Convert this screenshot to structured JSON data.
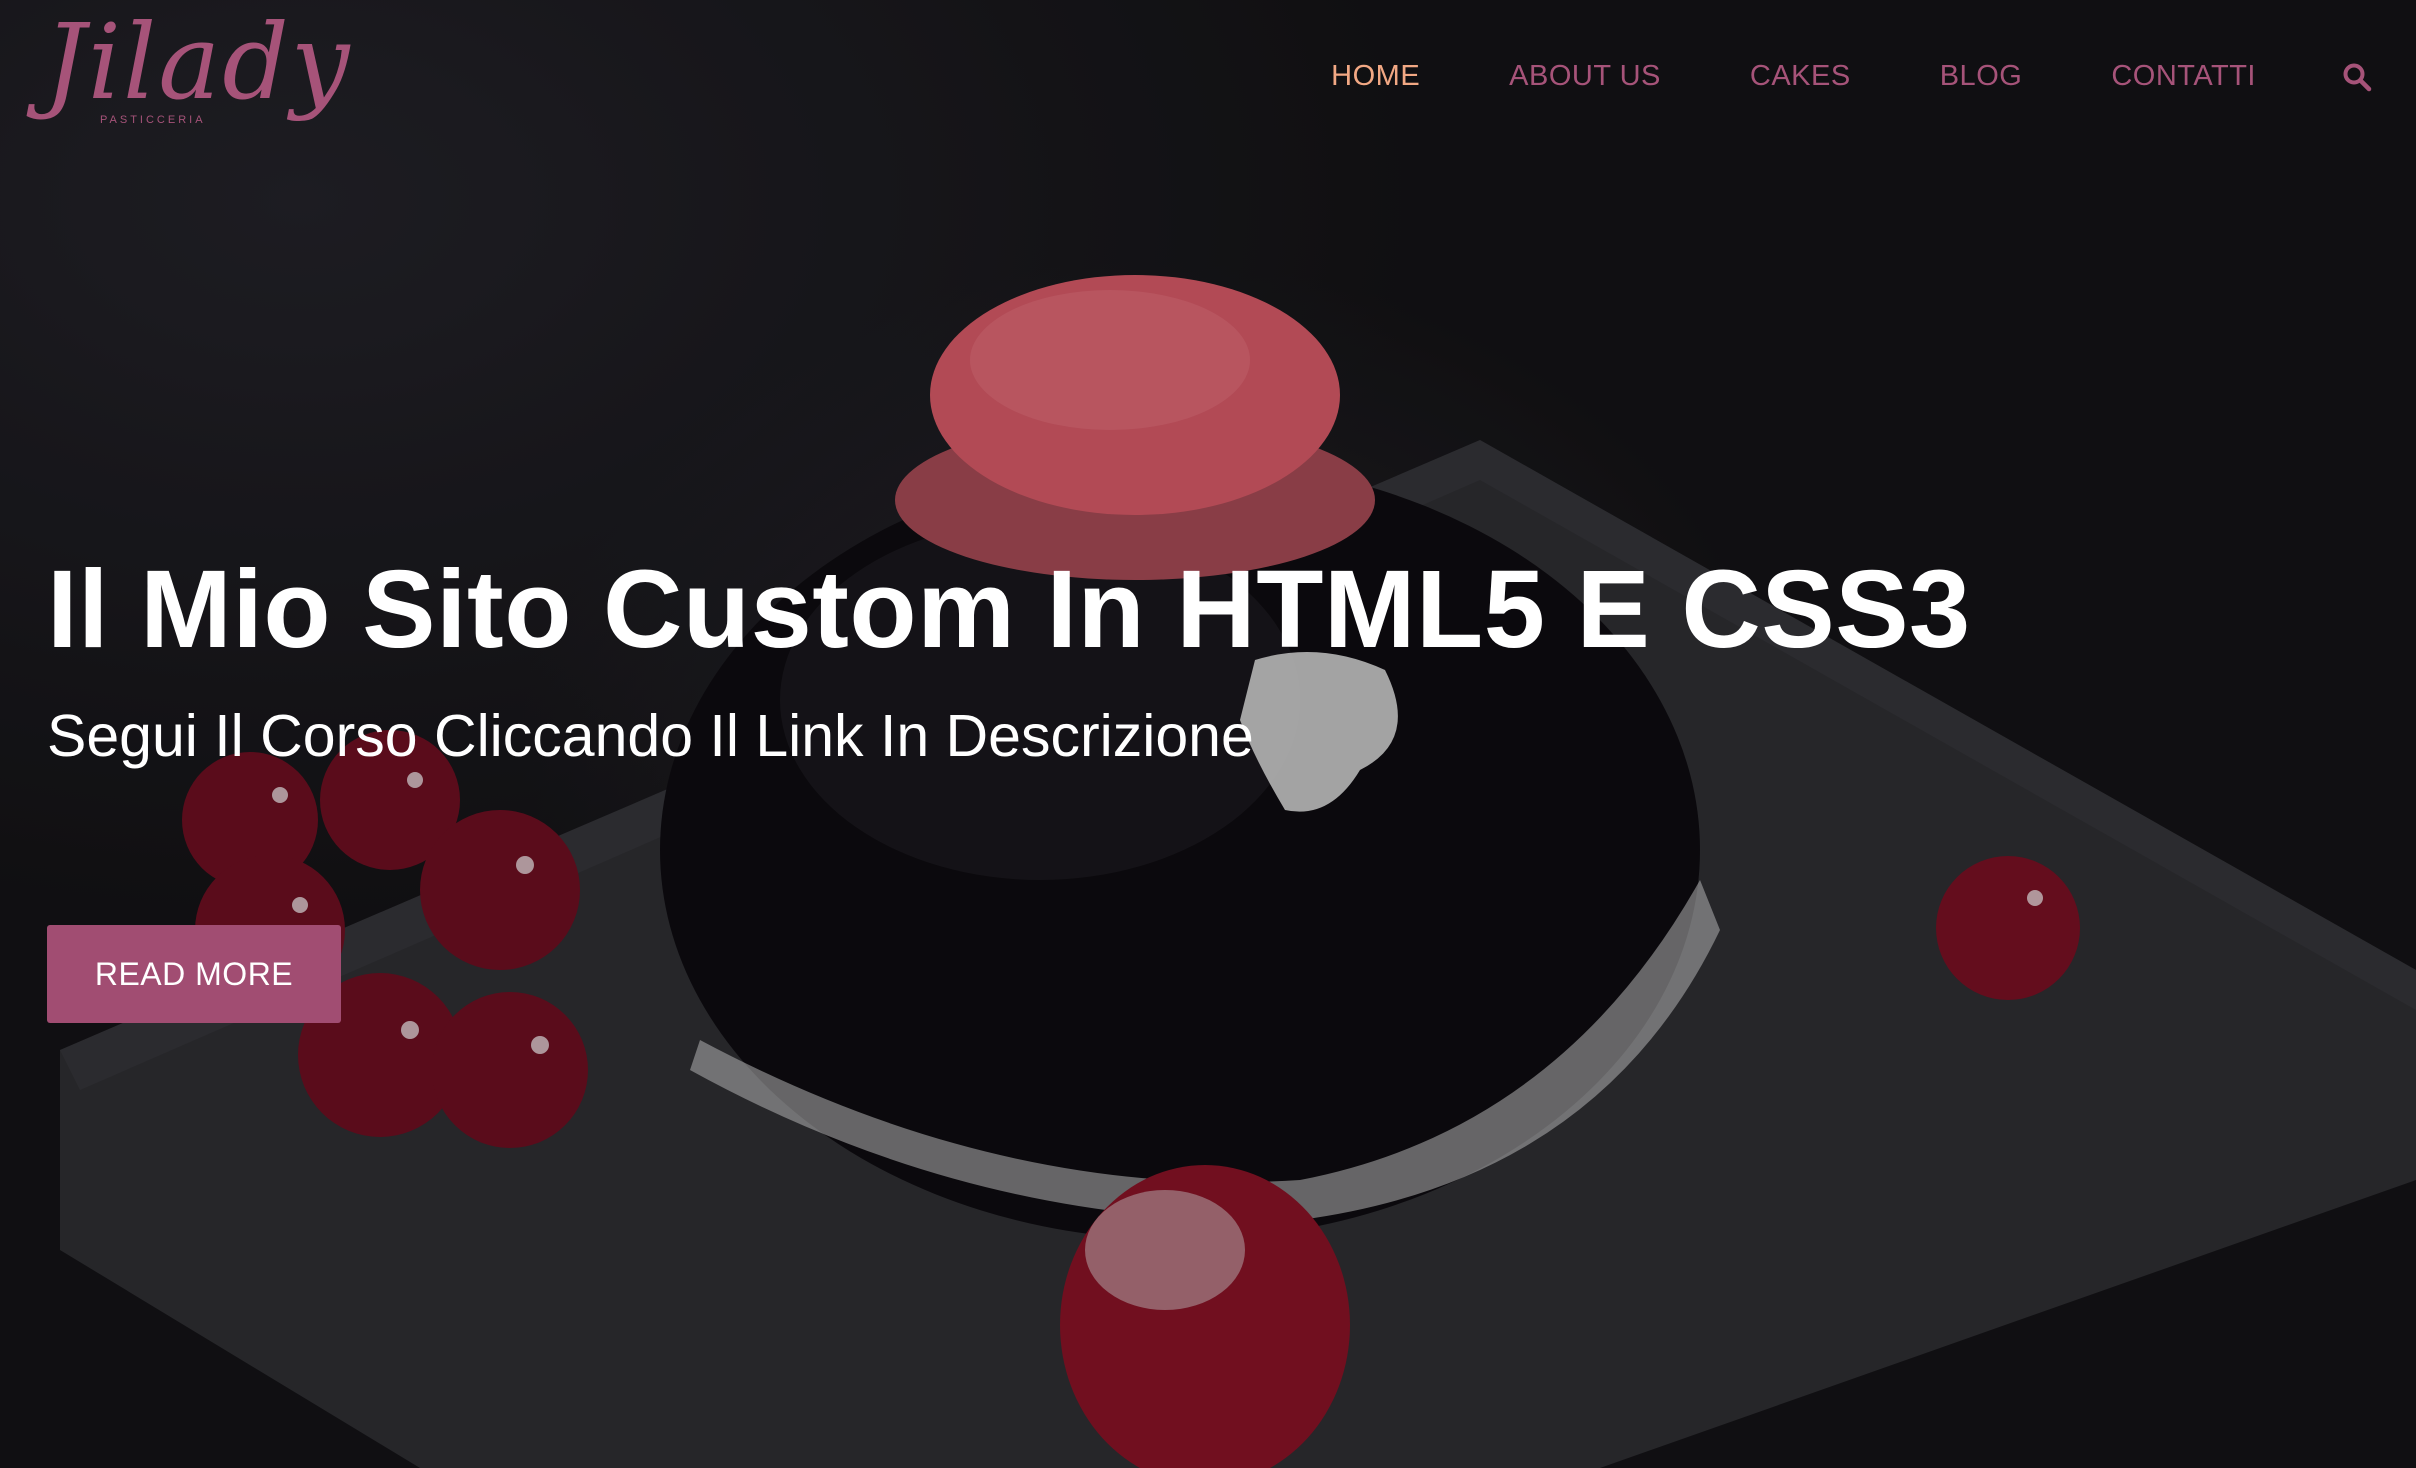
{
  "brand": {
    "logo_text": "Jilady",
    "logo_sub": "PASTICCERIA"
  },
  "nav": {
    "items": [
      {
        "label": "HOME",
        "active": true
      },
      {
        "label": "ABOUT US",
        "active": false
      },
      {
        "label": "CAKES",
        "active": false
      },
      {
        "label": "BLOG",
        "active": false
      },
      {
        "label": "CONTATTI",
        "active": false
      }
    ],
    "search_icon": "search-icon"
  },
  "hero": {
    "title": "Il Mio Sito Custom In HTML5 E CSS3",
    "subtitle": "Segui Il Corso Cliccando Il Link In Descrizione",
    "cta_label": "READ MORE"
  },
  "colors": {
    "accent": "#a65379",
    "active_nav": "#f2a884",
    "button_bg": "#a14d72",
    "background": "#1b1a1d"
  }
}
